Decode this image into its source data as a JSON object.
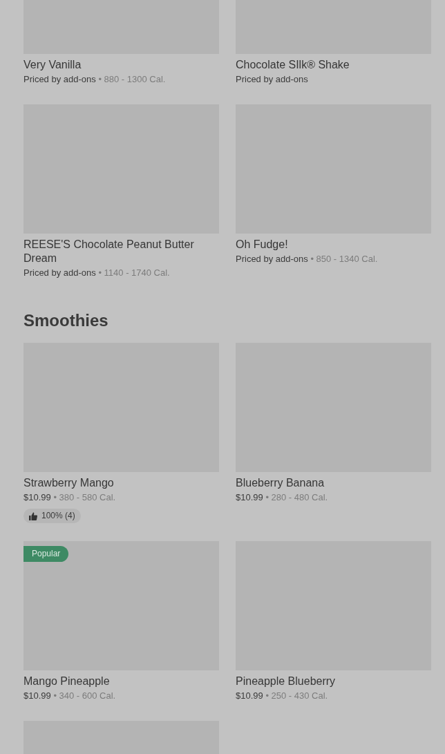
{
  "sections": [
    {
      "items": [
        {
          "kind": "item",
          "name": "Very Vanilla",
          "price": "Priced by add-ons",
          "calories": "• 880 - 1300 Cal."
        },
        {
          "kind": "item",
          "name": "Chocolate SIlk® Shake",
          "price": "Priced by add-ons"
        },
        {
          "kind": "item",
          "name": "REESE'S Chocolate Peanut Butter Dream",
          "price": "Priced by add-ons",
          "calories": "• 1140 - 1740 Cal."
        },
        {
          "kind": "item",
          "name": "Oh Fudge!",
          "price": "Priced by add-ons",
          "calories": "• 850 - 1340 Cal."
        }
      ]
    },
    {
      "title": "Smoothies",
      "items": [
        {
          "kind": "item",
          "name": "Strawberry Mango",
          "price": "$10.99",
          "calories": "• 380 - 580 Cal.",
          "rating": "100% (4)"
        },
        {
          "kind": "item",
          "name": "Blueberry Banana",
          "price": "$10.99",
          "calories": "• 280 - 480 Cal."
        },
        {
          "kind": "item",
          "name": "Mango Pineapple",
          "price": "$10.99",
          "calories": "• 340 - 600 Cal.",
          "badge": "Popular"
        },
        {
          "kind": "item",
          "name": "Pineapple Blueberry",
          "price": "$10.99",
          "calories": "• 250 - 430 Cal."
        },
        {
          "kind": "picture"
        }
      ]
    }
  ]
}
